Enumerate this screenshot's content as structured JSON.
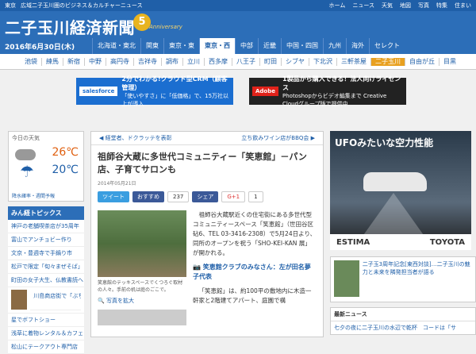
{
  "topbar": {
    "left": [
      "東京",
      "広域二子玉川圏のビジネス＆カルチャーニュース"
    ],
    "right": [
      "ホーム",
      "ニュース",
      "天気",
      "地図",
      "写真",
      "特集",
      "住まい"
    ]
  },
  "header": {
    "logo": "二子玉川経済新聞",
    "anniversary_number": "5",
    "anniversary_text": "Anniversary"
  },
  "datebar": {
    "date": "2016年6月30日(木)",
    "regions": [
      "北海道・東北",
      "関東",
      "東京・東",
      "東京・西",
      "中部",
      "近畿",
      "中国・四国",
      "九州",
      "海外",
      "セレクト"
    ],
    "active_region": "東京・西"
  },
  "stations": {
    "items": [
      "池袋",
      "練馬",
      "新宿",
      "中野",
      "高円寺",
      "吉祥寺",
      "調布",
      "立川",
      "西多摩",
      "八王子",
      "町田",
      "シブヤ",
      "下北沢",
      "三軒茶屋",
      "二子玉川",
      "自由が丘",
      "目黒"
    ],
    "active": "二子玉川"
  },
  "ads": {
    "ad1": {
      "tag": "salesforce",
      "headline": "2分でわかる!クラウド型CRM（顧客管理）",
      "body": "「使いやすさ」に「低価格」で、15万社以上が導入"
    },
    "ad2": {
      "tag": "Adobe",
      "headline": "1製品から購入できる！法人向けライセンス",
      "body": "Photoshopからビデオ編集まで Creative Cloudグループ版で提供中"
    }
  },
  "left": {
    "weather_title": "今日の天気",
    "temp_high": "26℃",
    "temp_low": "20℃",
    "rain": "降水確率・週間予報",
    "topics_title": "みん経トピックス",
    "topics": [
      "神戸の老舗喫茶店が35周年",
      "富山でアンチョビー作り",
      "文京・豊週寺で手鍋り市",
      "松戸で限定「旬々まぜそば」",
      "町田の女子大生、仏教書読へ"
    ],
    "image_topic": "川島商店街で「ぶち無農餅」",
    "topics2": [
      "星でボフトショー",
      "浅草に着物レンタル＆カフェ",
      "松山にテークアウト専門店"
    ]
  },
  "article": {
    "subnav_left": "経堂者、ドクラッテを表彰",
    "subnav_right": "立ち飲みワイン店がBBQ会",
    "title": "祖師谷大蔵に多世代コミュニティー「笑恵館」－パン店、子育てサロンも",
    "date": "2014年05月21日",
    "tweet": "ツイート",
    "fb_like": "おすすめ",
    "fb_count": "237",
    "share": "シェア",
    "gplus": "G+1",
    "gplus_count": "1",
    "caption": "笑恵館のテッキスペースでくつろぐ取材の人々。手前の机は庭のごこで。",
    "more_photos": "写真を拡大",
    "para1": "祖師谷大蔵駅近くの住宅街にある多世代型コミュニティースペース「笑恵館」（世田谷区砧6、TEL 03-3416-2308）で5月24日より、同所のオープンを祝う「SHO-KEI-KAN 展」が開かれる。",
    "subhead": "笑恵館クラブのみなさん：左が田名夢子代表",
    "para2": "「笑恵館」は、約100平の敷地内に木造一軒家と2階建てアパート、庭園で構"
  },
  "right": {
    "ad_headline": "UFOみたいな空力性能",
    "ad_model": "ESTIMA",
    "ad_brand": "TOYOTA",
    "feature_text": "二子玉3周年記念[東西対談]…二子玉川の魅力と未来を隣発担当者が語る",
    "news_title": "最新ニュース",
    "news_item": "七夕の夜に二子玉川の水辺で乾杯　コードは「サ"
  }
}
